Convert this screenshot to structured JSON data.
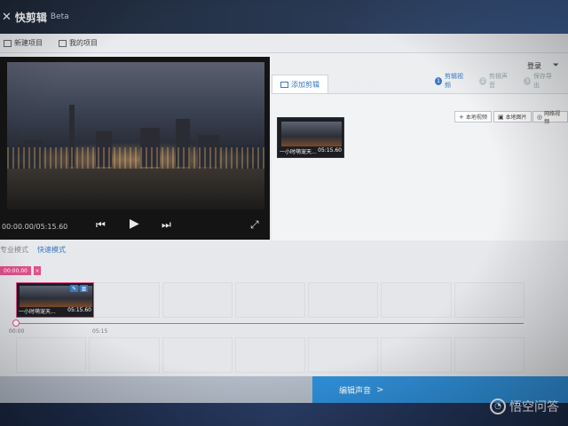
{
  "app": {
    "logo_glyph": "✕",
    "name": "快剪辑",
    "badge": "Beta"
  },
  "toolbar": {
    "new_project": "新建项目",
    "my_project": "我的项目"
  },
  "header_right": {
    "account": "登录"
  },
  "player": {
    "time": "00:00.00/05:15.60"
  },
  "media_panel": {
    "tab_label": "添加剪辑",
    "steps": [
      {
        "num": "1",
        "label": "剪辑视频",
        "active": true
      },
      {
        "num": "2",
        "label": "剪辑声音",
        "active": false
      },
      {
        "num": "3",
        "label": "保存导出",
        "active": false
      }
    ],
    "import_buttons": [
      "本地视频",
      "本地图片",
      "网络视频"
    ],
    "items": [
      {
        "title": "一小时萌宠天...",
        "duration": "05:15.60"
      }
    ]
  },
  "modes": {
    "pro": "专业模式",
    "fast": "快速模式"
  },
  "timeline": {
    "marker": "00:00.00",
    "marker_close": "×",
    "clip": {
      "title": "一小时萌宠天...",
      "duration": "05:15.60"
    },
    "ticks": [
      "00:00",
      "05:15"
    ]
  },
  "footer": {
    "next_label": "编辑声音",
    "next_chevron": ">"
  },
  "watermark": {
    "text": "悟空问答"
  },
  "colors": {
    "accent": "#3a78c2",
    "marker": "#e0508a",
    "next_button": "#2f8fd8"
  }
}
